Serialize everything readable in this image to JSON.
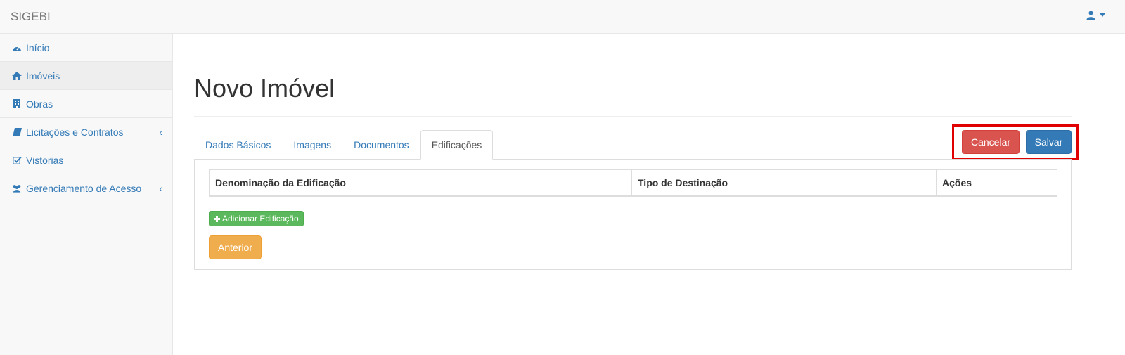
{
  "app": {
    "brand": "SIGEBI"
  },
  "header": {
    "user_icon": "user-icon"
  },
  "sidebar": {
    "items": [
      {
        "label": "Início",
        "icon": "dashboard-icon"
      },
      {
        "label": "Imóveis",
        "icon": "home-icon",
        "active": true
      },
      {
        "label": "Obras",
        "icon": "building-icon"
      },
      {
        "label": "Licitações e Contratos",
        "icon": "book-icon",
        "has_submenu": true
      },
      {
        "label": "Vistorias",
        "icon": "check-square-icon"
      },
      {
        "label": "Gerenciamento de Acesso",
        "icon": "users-icon",
        "has_submenu": true
      }
    ],
    "chevron": "‹"
  },
  "main": {
    "title": "Novo Imóvel",
    "tabs": [
      {
        "label": "Dados Básicos"
      },
      {
        "label": "Imagens"
      },
      {
        "label": "Documentos"
      },
      {
        "label": "Edificações",
        "active": true
      }
    ],
    "actions": {
      "cancel": "Cancelar",
      "save": "Salvar"
    },
    "table": {
      "columns": [
        "Denominação da Edificação",
        "Tipo de Destinação",
        "Ações"
      ]
    },
    "add_button": "Adicionar Edificação",
    "prev_button": "Anterior"
  },
  "colors": {
    "link": "#337ab7",
    "danger": "#d9534f",
    "primary": "#337ab7",
    "success": "#5cb85c",
    "warning": "#f0ad4e",
    "highlight": "#e00000"
  }
}
